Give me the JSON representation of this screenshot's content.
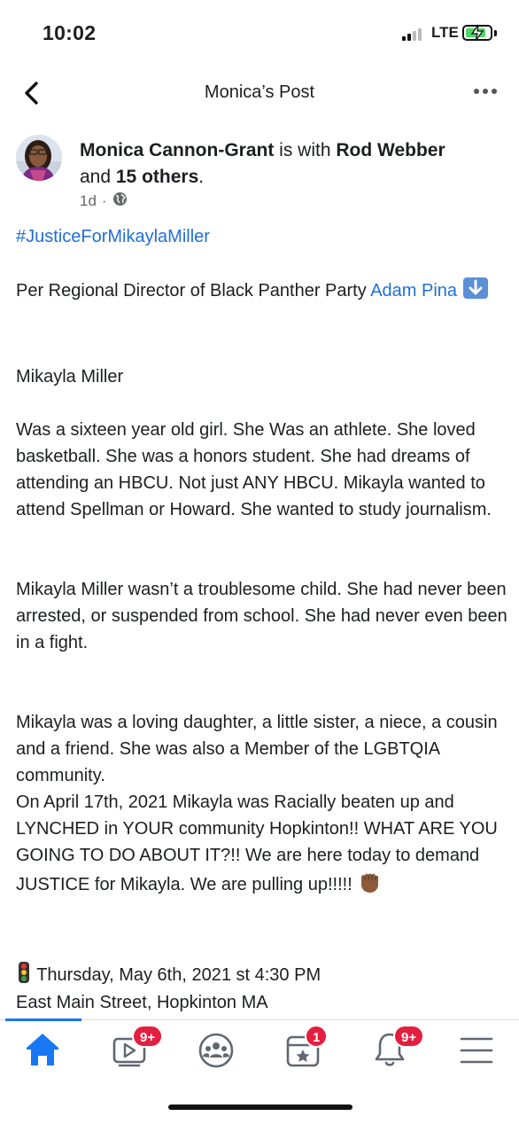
{
  "status_bar": {
    "time": "10:02",
    "network": "LTE",
    "colors": {
      "battery_fill": "#4cd964"
    }
  },
  "nav": {
    "title": "Monica’s Post",
    "back_icon": "chevron-left-icon",
    "more_icon": "ellipsis-icon"
  },
  "post": {
    "author": "Monica Cannon-Grant",
    "with_text": " is with ",
    "tagged": "Rod Webber",
    "and_text": "and ",
    "others": "15 others",
    "period": ".",
    "time_ago": "1d",
    "separator": "·",
    "privacy_icon": "globe-icon",
    "hashtag": "#JusticeForMikaylaMiller",
    "p1_text": "Per Regional Director of Black Panther Party ",
    "p1_link": "Adam Pina",
    "p2": "Mikayla Miller",
    "p3": "Was a sixteen year old girl. She Was an athlete. She loved basketball. She was a honors student. She had dreams of attending an HBCU. Not just ANY HBCU. Mikayla wanted to attend Spellman or Howard. She wanted to study journalism.",
    "p4": "Mikayla Miller wasn’t a troublesome child. She had never been arrested, or suspended from school. She had never even been in a fight.",
    "p5": "Mikayla was a loving daughter, a little sister, a niece, a cousin and a friend. She was also a Member of the LGBTQIA community.",
    "p6": "On April 17th, 2021 Mikayla was Racially beaten up and LYNCHED in YOUR community Hopkinton!! WHAT ARE YOU GOING TO DO ABOUT IT?!! We are here today to demand JUSTICE for Mikayla. We are pulling up!!!!!",
    "event_date": "Thursday, May 6th, 2021 st 4:30 PM",
    "event_place": "East Main Street, Hopkinton MA"
  },
  "tabs": [
    {
      "name": "home",
      "icon": "home-icon",
      "active": true,
      "badge": ""
    },
    {
      "name": "watch",
      "icon": "video-icon",
      "active": false,
      "badge": "9+"
    },
    {
      "name": "groups",
      "icon": "groups-icon",
      "active": false,
      "badge": ""
    },
    {
      "name": "events",
      "icon": "calendar-star-icon",
      "active": false,
      "badge": "1"
    },
    {
      "name": "notifications",
      "icon": "bell-icon",
      "active": false,
      "badge": "9+"
    },
    {
      "name": "menu",
      "icon": "hamburger-menu-icon",
      "active": false,
      "badge": ""
    }
  ],
  "colors": {
    "link": "#216fdb",
    "accent": "#1877f2",
    "badge": "#e41e3f",
    "icon_gray": "#606770"
  }
}
